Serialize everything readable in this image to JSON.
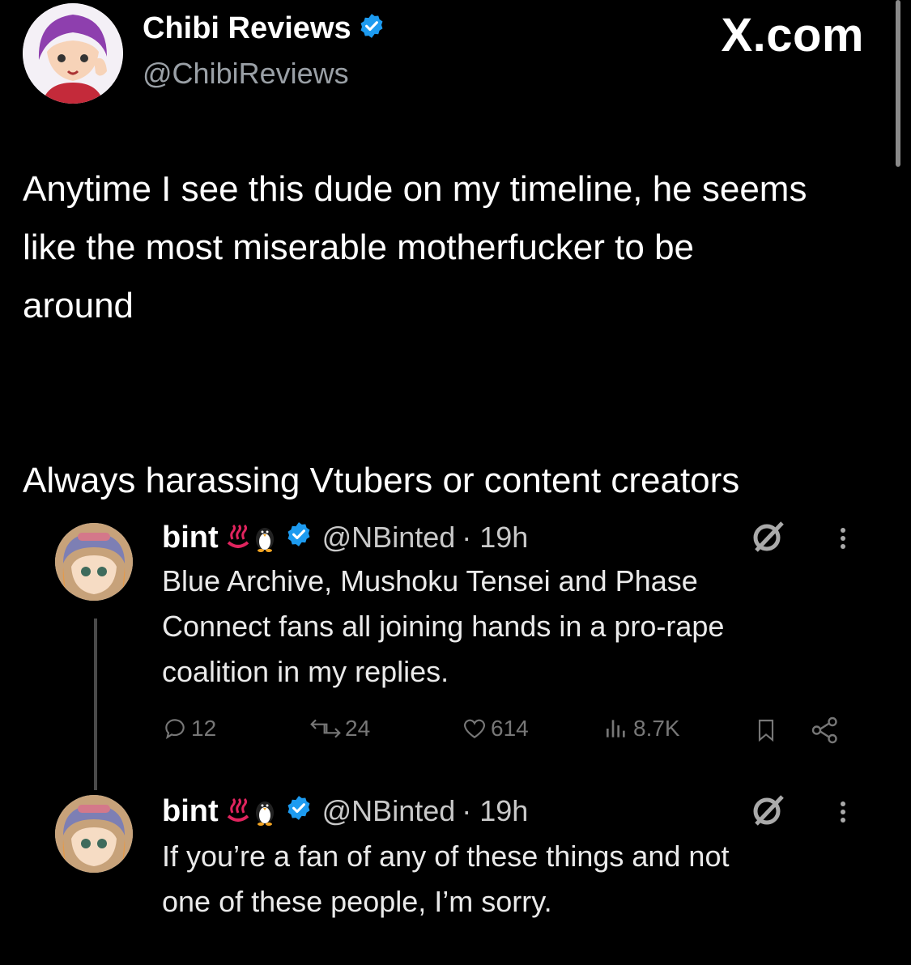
{
  "header": {
    "author_name": "Chibi Reviews",
    "author_handle": "@ChibiReviews",
    "brand": "X.com"
  },
  "tweet": {
    "text": "Anytime I see this dude on my timeline, he seems\nlike the most miserable motherfucker to be\naround\n\n\nAlways harassing Vtubers or content creators"
  },
  "quoted_thread": [
    {
      "name": "bint",
      "emoji": [
        "hot-springs-emoji",
        "penguin-emoji"
      ],
      "handle": "@NBinted",
      "time": "· 19h",
      "text_lines": [
        "Blue Archive, Mushoku Tensei and Phase",
        "Connect fans all joining hands in a pro-rape",
        "coalition in my replies."
      ],
      "actions": {
        "replies": "12",
        "reposts": "24",
        "likes": "614",
        "views": "8.7K"
      }
    },
    {
      "name": "bint",
      "emoji": [
        "hot-springs-emoji",
        "penguin-emoji"
      ],
      "handle": "@NBinted",
      "time": "· 19h",
      "text_lines": [
        "If you’re a fan of any of these things and not",
        "one of these people, I’m sorry."
      ]
    }
  ],
  "colors": {
    "background": "#000000",
    "verified_blue": "#1d9bf0",
    "secondary_text": "#9aa0a6"
  }
}
